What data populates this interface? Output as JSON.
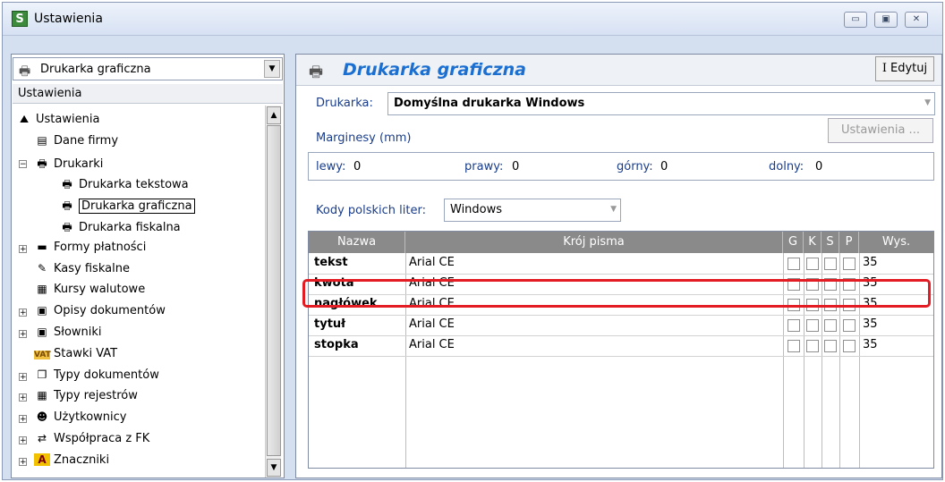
{
  "window": {
    "title": "Ustawienia",
    "app_icon_letter": "S",
    "min": "▭",
    "max": "▣",
    "close": "✕"
  },
  "left": {
    "combo_value": "Drukarka graficzna",
    "pane_header": "Ustawienia",
    "tree": [
      {
        "label": "Ustawienia",
        "icon": "settings-root-icon",
        "glyph": "⛰"
      },
      {
        "label": "Dane firmy",
        "icon": "company-card-icon",
        "glyph": "▤"
      },
      {
        "label": "Drukarki",
        "icon": "printer-icon",
        "glyph": "🖶",
        "expander": "−"
      },
      {
        "label": "Drukarka tekstowa",
        "icon": "printer-icon",
        "glyph": "🖶"
      },
      {
        "label": "Drukarka graficzna",
        "icon": "printer-icon",
        "glyph": "🖶"
      },
      {
        "label": "Drukarka fiskalna",
        "icon": "fiscal-printer-icon",
        "glyph": "🖶"
      },
      {
        "label": "Formy płatności",
        "icon": "payment-icon",
        "glyph": "▬",
        "expander": "+"
      },
      {
        "label": "Kasy fiskalne",
        "icon": "cash-register-icon",
        "glyph": "✎"
      },
      {
        "label": "Kursy walutowe",
        "icon": "currency-table-icon",
        "glyph": "▦"
      },
      {
        "label": "Opisy dokumentów",
        "icon": "document-desc-icon",
        "glyph": "▣",
        "expander": "+"
      },
      {
        "label": "Słowniki",
        "icon": "dictionary-icon",
        "glyph": "▣",
        "expander": "+"
      },
      {
        "label": "Stawki VAT",
        "icon": "vat-icon",
        "glyph": "VAT"
      },
      {
        "label": "Typy dokumentów",
        "icon": "document-types-icon",
        "glyph": "❐",
        "expander": "+"
      },
      {
        "label": "Typy rejestrów",
        "icon": "registers-icon",
        "glyph": "▦",
        "expander": "+"
      },
      {
        "label": "Użytkownicy",
        "icon": "users-icon",
        "glyph": "☻",
        "expander": "+"
      },
      {
        "label": "Współpraca z FK",
        "icon": "fk-icon",
        "glyph": "⇄",
        "expander": "+"
      },
      {
        "label": "Znaczniki",
        "icon": "markers-icon",
        "glyph": "A",
        "expander": "+"
      }
    ]
  },
  "right": {
    "title": "Drukarka graficzna",
    "edit_label": "Edytuj",
    "printer_label": "Drukarka:",
    "printer_value": "Domyślna drukarka Windows",
    "margins_label": "Marginesy (mm)",
    "settings_button": "Ustawienia ...",
    "margins": {
      "left_label": "lewy:",
      "left": "0",
      "right_label": "prawy:",
      "right": "0",
      "top_label": "górny:",
      "top": "0",
      "bottom_label": "dolny:",
      "bottom": "0"
    },
    "codes_label": "Kody polskich liter:",
    "codes_value": "Windows"
  },
  "grid": {
    "headers": {
      "name": "Nazwa",
      "font": "Krój pisma",
      "g": "G",
      "k": "K",
      "s": "S",
      "p": "P",
      "wys": "Wys."
    },
    "rows": [
      {
        "name": "tekst",
        "font": "Arial CE",
        "wys": "35"
      },
      {
        "name": "kwota",
        "font": "Arial CE",
        "wys": "35"
      },
      {
        "name": "nagłówek",
        "font": "Arial CE",
        "wys": "35"
      },
      {
        "name": "tytuł",
        "font": "Arial CE",
        "wys": "35"
      },
      {
        "name": "stopka",
        "font": "Arial CE",
        "wys": "35"
      }
    ]
  }
}
